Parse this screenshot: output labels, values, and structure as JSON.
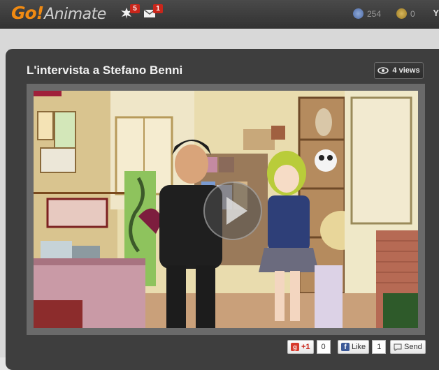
{
  "header": {
    "logo_go": "Go!",
    "logo_animate": "Animate",
    "notifications_count": "5",
    "messages_count": "1",
    "gobucks": "254",
    "gopoints": "0",
    "user_initial": "Y"
  },
  "video": {
    "title": "L'intervista a Stefano Benni",
    "views": "4 views"
  },
  "share": {
    "gplus_label": "+1",
    "gplus_count": "0",
    "fb_like_label": "Like",
    "fb_like_count": "1",
    "send_label": "Send"
  },
  "colors": {
    "accent": "#f08a12",
    "badge": "#c9261b",
    "panel": "#3e3e3e"
  }
}
